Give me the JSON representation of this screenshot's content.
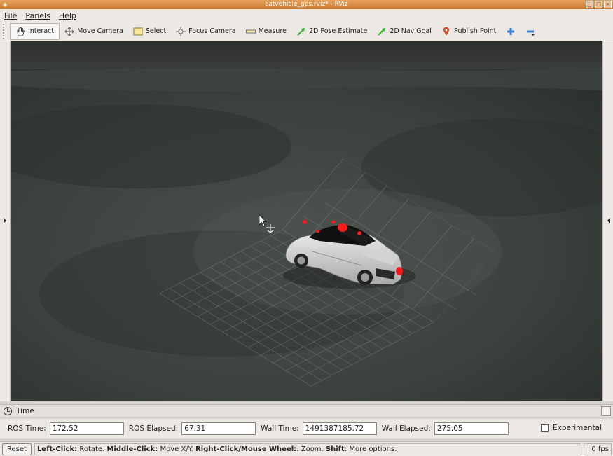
{
  "window": {
    "title": "catvehicle_gps.rviz* - RViz"
  },
  "menu": {
    "file": "File",
    "panels": "Panels",
    "help": "Help"
  },
  "toolbar": {
    "interact": "Interact",
    "move_camera": "Move Camera",
    "select": "Select",
    "focus_camera": "Focus Camera",
    "measure": "Measure",
    "pose_estimate": "2D Pose Estimate",
    "nav_goal": "2D Nav Goal",
    "publish_point": "Publish Point"
  },
  "time_panel": {
    "title": "Time",
    "ros_time_label": "ROS Time:",
    "ros_time": "172.52",
    "ros_elapsed_label": "ROS Elapsed:",
    "ros_elapsed": "67.31",
    "wall_time_label": "Wall Time:",
    "wall_time": "1491387185.72",
    "wall_elapsed_label": "Wall Elapsed:",
    "wall_elapsed": "275.05",
    "experimental_label": "Experimental"
  },
  "status": {
    "reset_label": "Reset",
    "hint_left_bold": "Left-Click:",
    "hint_left": " Rotate. ",
    "hint_middle_bold": "Middle-Click:",
    "hint_middle": " Move X/Y. ",
    "hint_right_bold": "Right-Click/Mouse Wheel:",
    "hint_right": ": Zoom. ",
    "hint_shift_bold": "Shift",
    "hint_shift": ": More options.",
    "fps": "0 fps"
  },
  "colors": {
    "accent": "#c9782e",
    "viewport_bg": "#313533",
    "marker": "#ff1a1a"
  }
}
